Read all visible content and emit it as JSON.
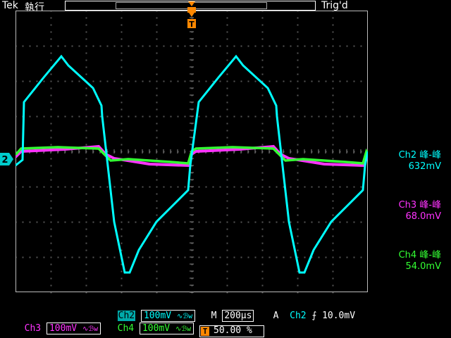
{
  "header": {
    "brand": "Tek",
    "run_status": "執行",
    "trigger_status": "Trig'd"
  },
  "ground_marker": "2",
  "trigger_marker": "T",
  "measurements": [
    {
      "label": "Ch2 峰-峰",
      "value": "632mV",
      "color": "#00ffff"
    },
    {
      "label": "Ch3 峰-峰",
      "value": "68.0mV",
      "color": "#ff33ff"
    },
    {
      "label": "Ch4 峰-峰",
      "value": "54.0mV",
      "color": "#33ff33"
    }
  ],
  "settings": {
    "ch2": {
      "name": "Ch2",
      "scale": "100mV",
      "coupling": "∿ℬw"
    },
    "ch3": {
      "name": "Ch3",
      "scale": "100mV",
      "coupling": "∿ℬw"
    },
    "ch4": {
      "name": "Ch4",
      "scale": "100mV",
      "coupling": "∿ℬw"
    },
    "timebase": {
      "label": "M",
      "value": "200µs"
    },
    "trigger": {
      "mode": "A",
      "source": "Ch2",
      "slope": "⨍",
      "level": "10.0mV"
    },
    "trigger_position": "50.00 %"
  },
  "colors": {
    "ch2": "#00ffff",
    "ch3": "#ff33ff",
    "ch4": "#33ff33",
    "trigger": "#ff8800",
    "brand": "#3355ff"
  }
}
